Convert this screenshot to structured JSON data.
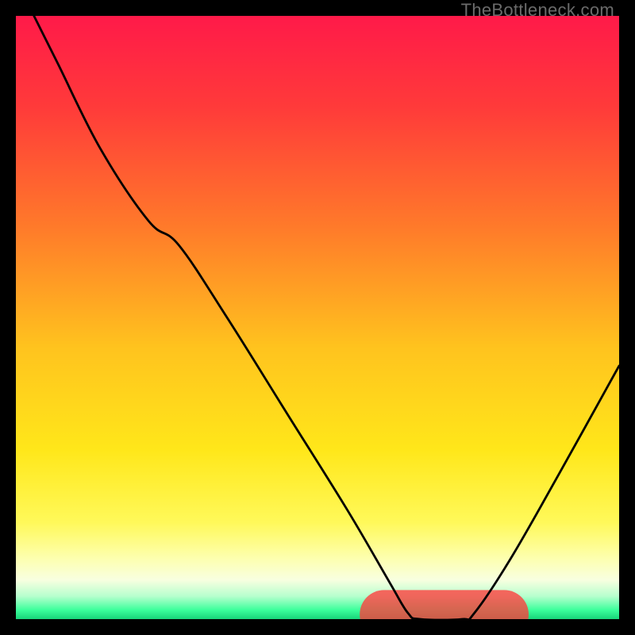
{
  "watermark": "TheBottleneck.com",
  "chart_data": {
    "type": "line",
    "title": "",
    "xlabel": "",
    "ylabel": "",
    "xlim": [
      0,
      100
    ],
    "ylim": [
      0,
      100
    ],
    "grid": false,
    "legend": null,
    "background_gradient": {
      "stops": [
        {
          "offset": 0.0,
          "color": "#ff1a49"
        },
        {
          "offset": 0.15,
          "color": "#ff3a3a"
        },
        {
          "offset": 0.35,
          "color": "#ff7a2a"
        },
        {
          "offset": 0.55,
          "color": "#ffc31e"
        },
        {
          "offset": 0.72,
          "color": "#ffe71a"
        },
        {
          "offset": 0.84,
          "color": "#fff95a"
        },
        {
          "offset": 0.9,
          "color": "#fdffb0"
        },
        {
          "offset": 0.935,
          "color": "#f8ffe0"
        },
        {
          "offset": 0.962,
          "color": "#b7ffce"
        },
        {
          "offset": 0.985,
          "color": "#3bff9b"
        },
        {
          "offset": 1.0,
          "color": "#18d47a"
        }
      ]
    },
    "series": [
      {
        "name": "bottleneck-curve",
        "points": [
          {
            "x": 3,
            "y": 100
          },
          {
            "x": 7,
            "y": 92
          },
          {
            "x": 14,
            "y": 78
          },
          {
            "x": 22,
            "y": 66
          },
          {
            "x": 27,
            "y": 62
          },
          {
            "x": 35,
            "y": 50
          },
          {
            "x": 45,
            "y": 34
          },
          {
            "x": 55,
            "y": 18
          },
          {
            "x": 62,
            "y": 6
          },
          {
            "x": 65,
            "y": 1
          },
          {
            "x": 67,
            "y": 0
          },
          {
            "x": 74,
            "y": 0
          },
          {
            "x": 76,
            "y": 1
          },
          {
            "x": 82,
            "y": 10
          },
          {
            "x": 90,
            "y": 24
          },
          {
            "x": 100,
            "y": 42
          }
        ]
      }
    ],
    "marker": {
      "x": 71,
      "y": 0,
      "rx": 14,
      "ry": 7
    }
  }
}
